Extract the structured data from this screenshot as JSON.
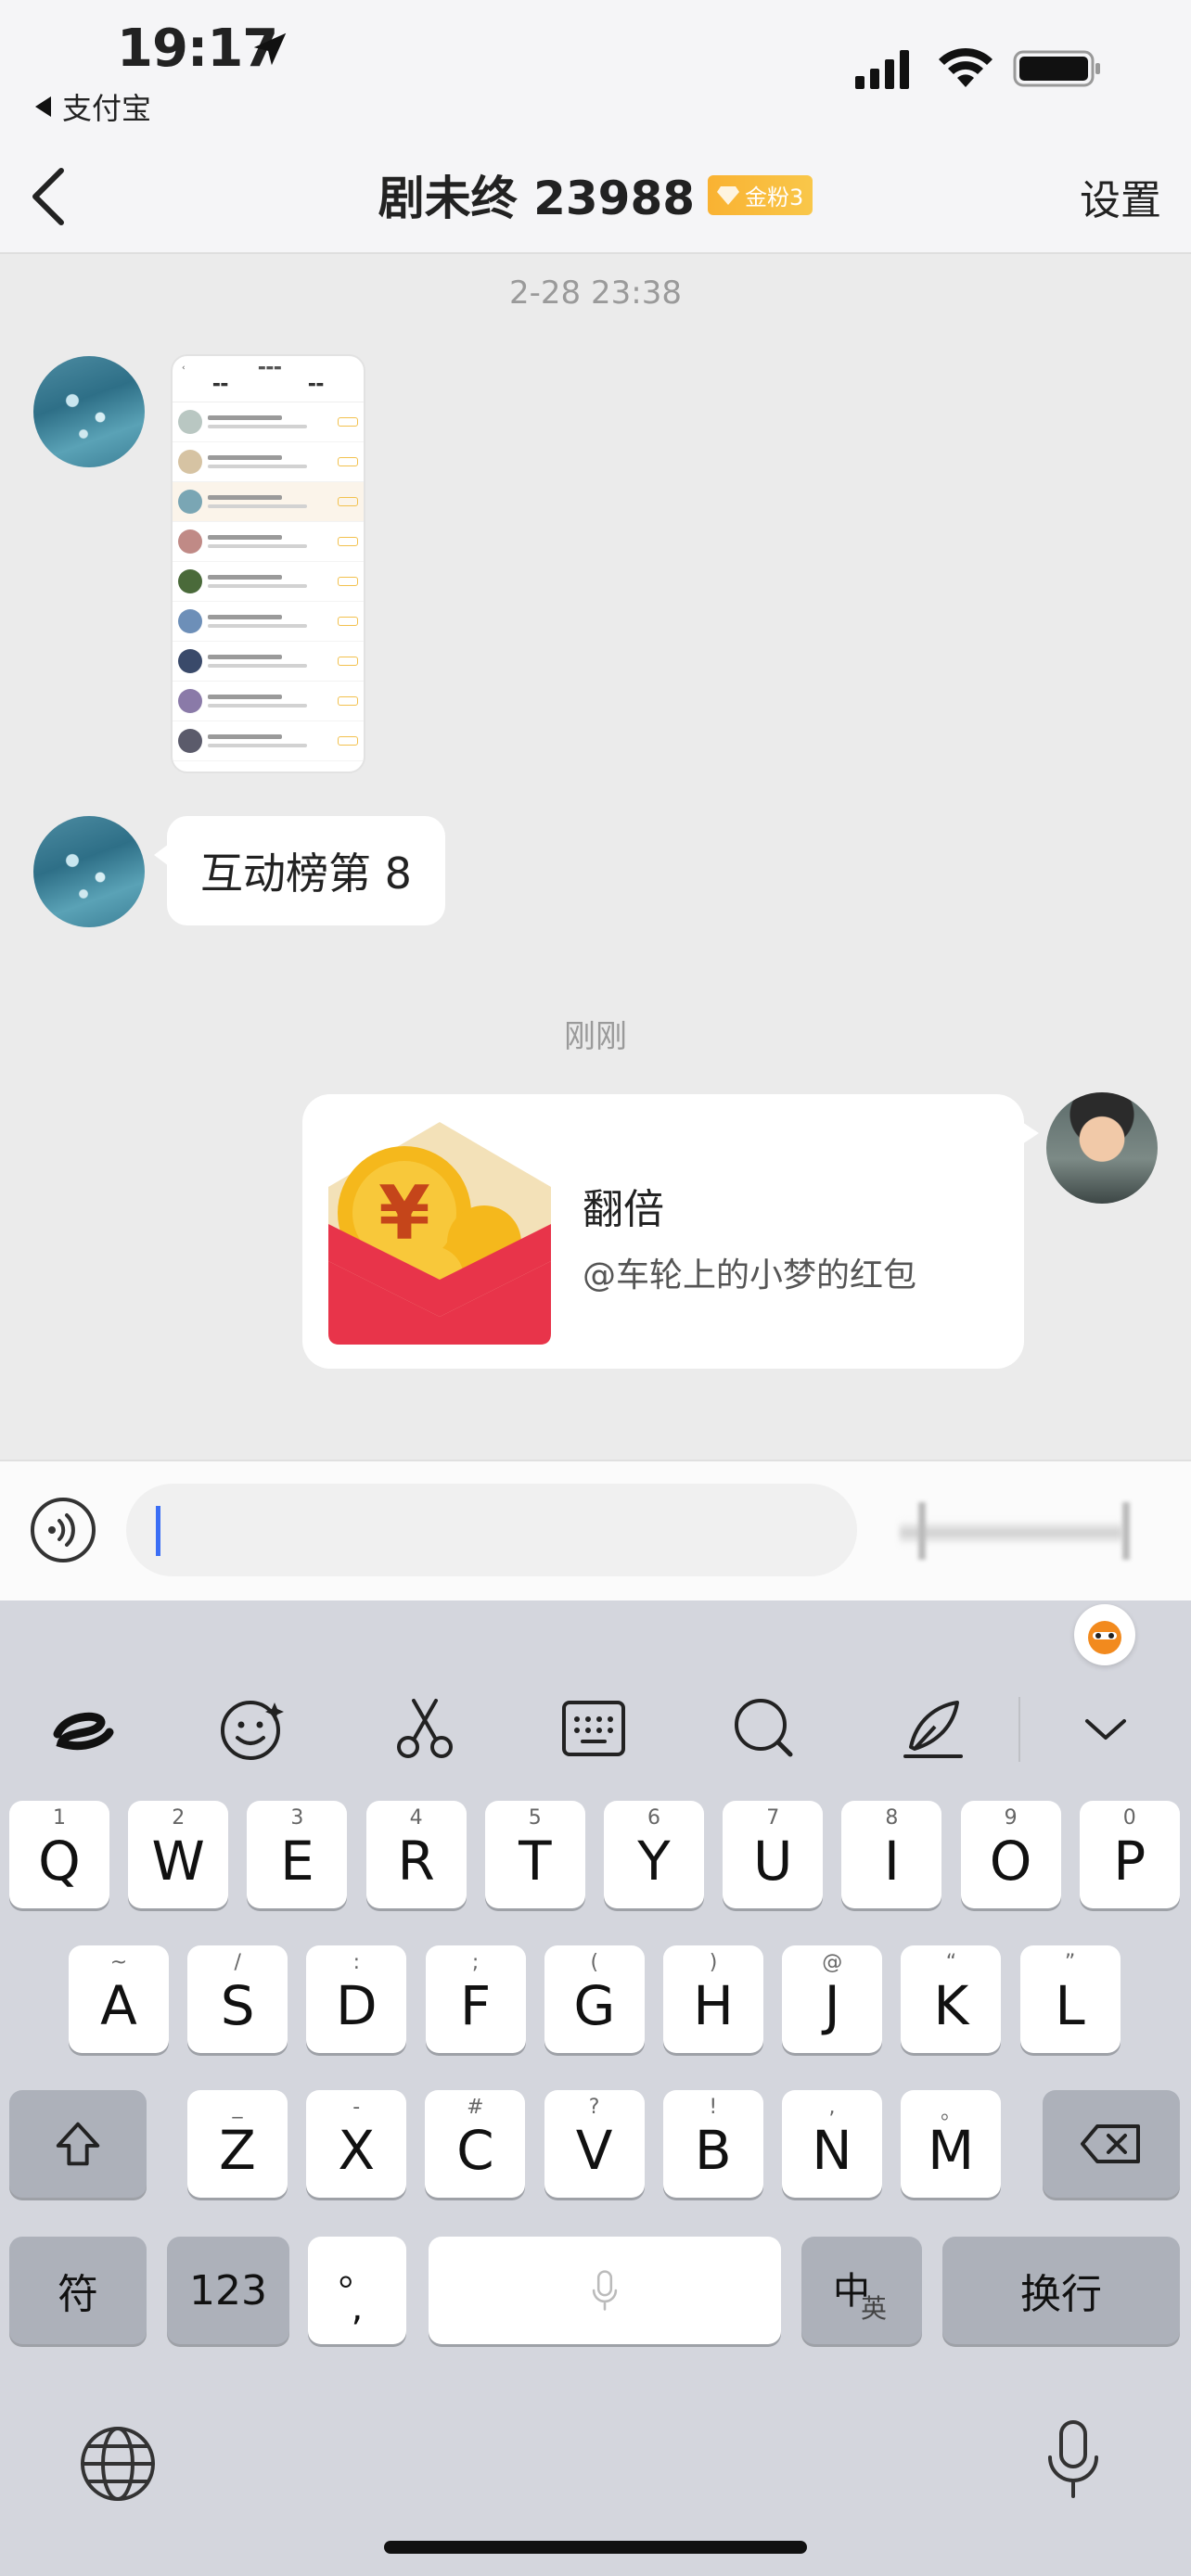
{
  "status_bar": {
    "time": "19:17",
    "back_app": "支付宝"
  },
  "nav": {
    "title": "剧未终 23988",
    "badge": "金粉3",
    "settings": "设置"
  },
  "chat": {
    "timestamp_1": "2-28 23:38",
    "message_text": "互动榜第 8",
    "timestamp_2": "刚刚",
    "red_packet": {
      "title": "翻倍",
      "subtitle": "@车轮上的小梦的红包"
    }
  },
  "input": {
    "value": "",
    "placeholder": ""
  },
  "keyboard": {
    "row1": [
      {
        "key": "Q",
        "hint": "1"
      },
      {
        "key": "W",
        "hint": "2"
      },
      {
        "key": "E",
        "hint": "3"
      },
      {
        "key": "R",
        "hint": "4"
      },
      {
        "key": "T",
        "hint": "5"
      },
      {
        "key": "Y",
        "hint": "6"
      },
      {
        "key": "U",
        "hint": "7"
      },
      {
        "key": "I",
        "hint": "8"
      },
      {
        "key": "O",
        "hint": "9"
      },
      {
        "key": "P",
        "hint": "0"
      }
    ],
    "row2": [
      {
        "key": "A",
        "hint": "~"
      },
      {
        "key": "S",
        "hint": "/"
      },
      {
        "key": "D",
        "hint": ":"
      },
      {
        "key": "F",
        "hint": ";"
      },
      {
        "key": "G",
        "hint": "("
      },
      {
        "key": "H",
        "hint": ")"
      },
      {
        "key": "J",
        "hint": "@"
      },
      {
        "key": "K",
        "hint": "“"
      },
      {
        "key": "L",
        "hint": "”"
      }
    ],
    "row3": [
      {
        "key": "Z",
        "hint": "_"
      },
      {
        "key": "X",
        "hint": "-"
      },
      {
        "key": "C",
        "hint": "#"
      },
      {
        "key": "V",
        "hint": "?"
      },
      {
        "key": "B",
        "hint": "!"
      },
      {
        "key": "N",
        "hint": ","
      },
      {
        "key": "M",
        "hint": "。"
      }
    ],
    "symbols_label": "符",
    "numbers_label": "123",
    "punct_top": "。",
    "punct_bottom": ",",
    "lang_main": "中",
    "lang_sub": "英",
    "enter_label": "换行"
  },
  "colors": {
    "accent_caret": "#3b6ef5",
    "badge_gold": "#f9b232",
    "red_packet_red": "#e8344a"
  }
}
